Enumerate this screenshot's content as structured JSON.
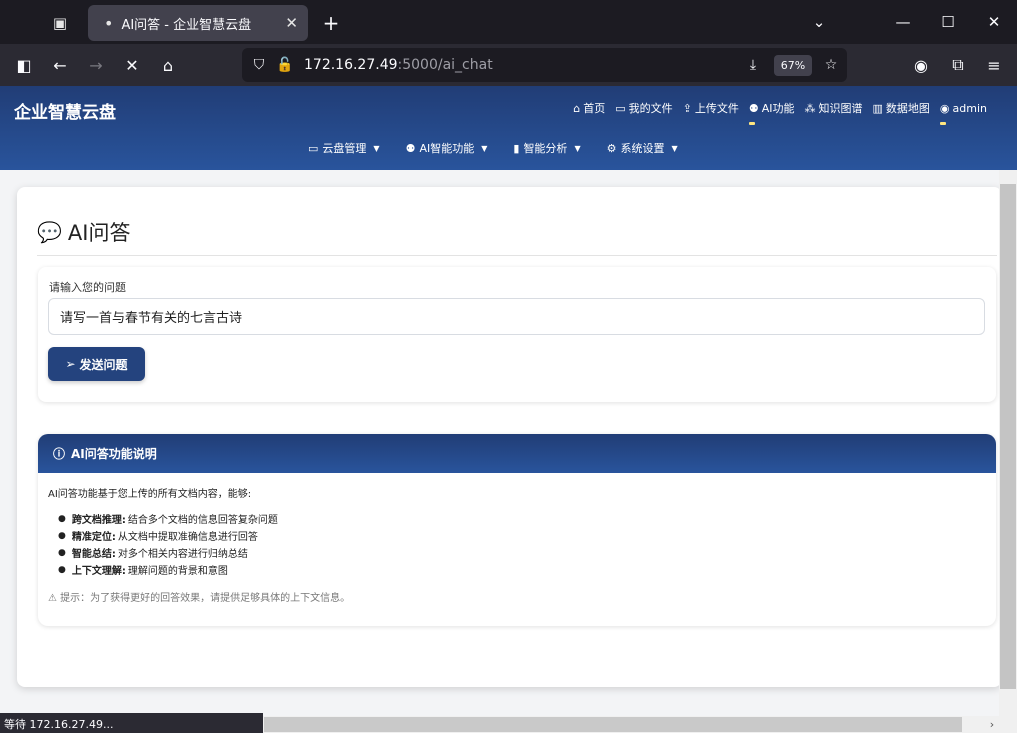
{
  "browser": {
    "tab_title": "AI问答 - 企业智慧云盘",
    "tab_dot": "•",
    "tab_close": "✕",
    "new_tab": "+",
    "list_tabs": "⌄",
    "minimize": "—",
    "maximize": "☐",
    "close": "✕",
    "url_host": "172.16.27.49",
    "url_rest": ":5000/ai_chat",
    "zoom": "67%",
    "status": "等待 172.16.27.49..."
  },
  "site": {
    "brand": "企业智慧云盘",
    "top_links": [
      {
        "label": "首页",
        "icon": "⌂"
      },
      {
        "label": "我的文件",
        "icon": "▭"
      },
      {
        "label": "上传文件",
        "icon": "⇪"
      },
      {
        "label": "AI功能",
        "icon": "⚉"
      },
      {
        "label": "知识图谱",
        "icon": "⁂"
      },
      {
        "label": "数据地图",
        "icon": "▥"
      },
      {
        "label": "admin",
        "icon": "◉"
      }
    ],
    "menus": [
      {
        "label": "云盘管理",
        "icon": "▭"
      },
      {
        "label": "AI智能功能",
        "icon": "⚉"
      },
      {
        "label": "智能分析",
        "icon": "▮"
      },
      {
        "label": "系统设置",
        "icon": "⚙"
      }
    ]
  },
  "page": {
    "title": "AI问答",
    "title_icon": "💬",
    "question_label": "请输入您的问题",
    "question_value": "请写一首与春节有关的七言古诗",
    "send_label": "发送问题",
    "send_icon": "➢",
    "info_title": "AI问答功能说明",
    "info_icon": "ⓘ",
    "info_intro": "AI问答功能基于您上传的所有文档内容，能够:",
    "features": [
      {
        "name": "跨文档推理:",
        "desc": "结合多个文档的信息回答复杂问题"
      },
      {
        "name": "精准定位:",
        "desc": "从文档中提取准确信息进行回答"
      },
      {
        "name": "智能总结:",
        "desc": "对多个相关内容进行归纳总结"
      },
      {
        "name": "上下文理解:",
        "desc": "理解问题的背景和意图"
      }
    ],
    "tip": "⚠ 提示：为了获得更好的回答效果，请提供足够具体的上下文信息。"
  }
}
